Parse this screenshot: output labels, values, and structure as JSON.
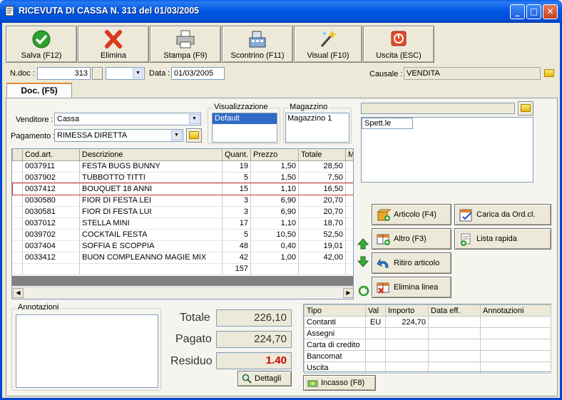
{
  "window": {
    "title": "RICEVUTA DI CASSA N.  313  del 01/03/2005",
    "min": "_",
    "max": "□",
    "close": "✕"
  },
  "toolbar": [
    {
      "label": "Salva (F12)",
      "icon": "check-icon"
    },
    {
      "label": "Elimina",
      "icon": "delete-x-icon"
    },
    {
      "label": "Stampa (F9)",
      "icon": "printer-icon"
    },
    {
      "label": "Scontrino (F11)",
      "icon": "cash-register-icon"
    },
    {
      "label": "Visual (F10)",
      "icon": "magic-wand-icon"
    },
    {
      "label": "Uscita (ESC)",
      "icon": "power-icon"
    }
  ],
  "header": {
    "ndoc_label": "N.doc :",
    "ndoc_value": "313",
    "data_label": "Data :",
    "data_value": "01/03/2005",
    "causale_label": "Causale :",
    "causale_value": "VENDITA"
  },
  "tab": {
    "label": "Doc. (F5)"
  },
  "form": {
    "venditore_label": "Venditore :",
    "venditore_value": "Cassa",
    "pagamento_label": "Pagamento :",
    "pagamento_value": "RIMESSA DIRETTA"
  },
  "visualizzazione": {
    "title": "Visualizzazione",
    "items": [
      "Default"
    ]
  },
  "magazzino": {
    "title": "Magazzino",
    "items": [
      "Magazzino 1"
    ]
  },
  "customer": {
    "field_value": "",
    "spett_value": "Spett.le"
  },
  "grid": {
    "headers": [
      "Cod.art.",
      "Descrizione",
      "Quant.",
      "Prezzo",
      "Totale",
      "M"
    ],
    "rows": [
      [
        "0037911",
        "FESTA BUGS BUNNY",
        "19",
        "1,50",
        "28,50"
      ],
      [
        "0037902",
        "TUBBOTTO TITTI",
        "5",
        "1,50",
        "7,50"
      ],
      [
        "0037412",
        "BOUQUET 18 ANNI",
        "15",
        "1,10",
        "16,50"
      ],
      [
        "0030580",
        "FIOR DI FESTA LEI",
        "3",
        "6,90",
        "20,70"
      ],
      [
        "0030581",
        "FIOR DI FESTA LUI",
        "3",
        "6,90",
        "20,70"
      ],
      [
        "0037012",
        "STELLA MINI",
        "17",
        "1,10",
        "18,70"
      ],
      [
        "0039702",
        "COCKTAIL FESTA",
        "5",
        "10,50",
        "52,50"
      ],
      [
        "0037404",
        "SOFFIA E SCOPPIA",
        "48",
        "0,40",
        "19,01"
      ],
      [
        "0033412",
        "BUON COMPLEANNO MAGIE MIX",
        "42",
        "1,00",
        "42,00"
      ]
    ],
    "total_qty": "157"
  },
  "actions": {
    "articolo": "Articolo (F4)",
    "carica": "Carica da Ord.cl.",
    "altro": "Altro (F3)",
    "lista": "Lista rapida",
    "ritiro": "Ritiro articolo",
    "elimina": "Elimina linea"
  },
  "annotazioni": {
    "title": "Annotazioni"
  },
  "totals": {
    "totale_label": "Totale",
    "totale_value": "226,10",
    "pagato_label": "Pagato",
    "pagato_value": "224,70",
    "residuo_label": "Residuo",
    "residuo_value": "1.40",
    "dettagli": "Dettagli",
    "residuo_color": "#cc0000"
  },
  "payments": {
    "headers": [
      "Tipo",
      "Val",
      "Importo",
      "Data eff.",
      "Annotazioni"
    ],
    "rows": [
      [
        "Contanti",
        "EU",
        "224,70",
        "",
        ""
      ],
      [
        "Assegni",
        "",
        "",
        "",
        ""
      ],
      [
        "Carta di credito",
        "",
        "",
        "",
        ""
      ],
      [
        "Bancomat",
        "",
        "",
        "",
        ""
      ],
      [
        "Uscita",
        "",
        "",
        "",
        ""
      ]
    ]
  },
  "incasso": {
    "label": "Incasso (F8)"
  }
}
